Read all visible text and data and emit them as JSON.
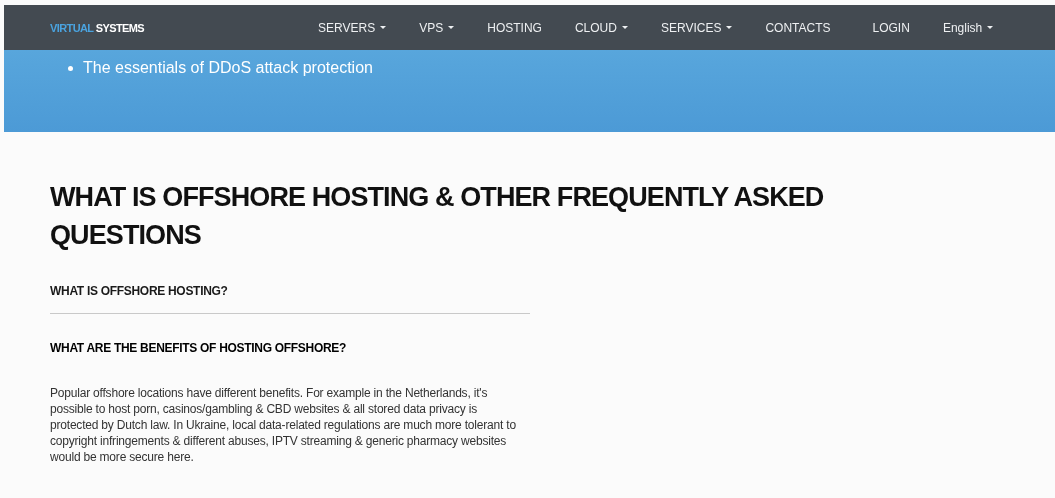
{
  "logo": {
    "part_1": "VIRTUAL",
    "part_2": "SYSTEMS"
  },
  "nav": [
    {
      "label": "SERVERS",
      "dropdown": true
    },
    {
      "label": "VPS",
      "dropdown": true
    },
    {
      "label": "HOSTING",
      "dropdown": false
    },
    {
      "label": "CLOUD",
      "dropdown": true
    },
    {
      "label": "SERVICES",
      "dropdown": true
    },
    {
      "label": "CONTACTS",
      "dropdown": false
    },
    {
      "label": "LOGIN",
      "dropdown": false
    },
    {
      "label": "English",
      "dropdown": true
    }
  ],
  "banner": {
    "items": [
      "The essentials of DDoS attack protection"
    ]
  },
  "heading": "WHAT IS OFFSHORE HOSTING & OTHER FREQUENTLY ASKED QUESTIONS",
  "faq": [
    {
      "question": "WHAT IS OFFSHORE HOSTING?",
      "expanded": false
    },
    {
      "question": "WHAT ARE THE BENEFITS OF HOSTING OFFSHORE?",
      "expanded": true,
      "answer": "Popular offshore locations have different benefits. For example in the Netherlands, it's possible to host porn, casinos/gambling & CBD websites & all stored data privacy is protected by Dutch law. In Ukraine, local data-related regulations are much more tolerant to copyright infringements & different abuses, IPTV streaming & generic pharmacy websites would be more secure here."
    }
  ]
}
